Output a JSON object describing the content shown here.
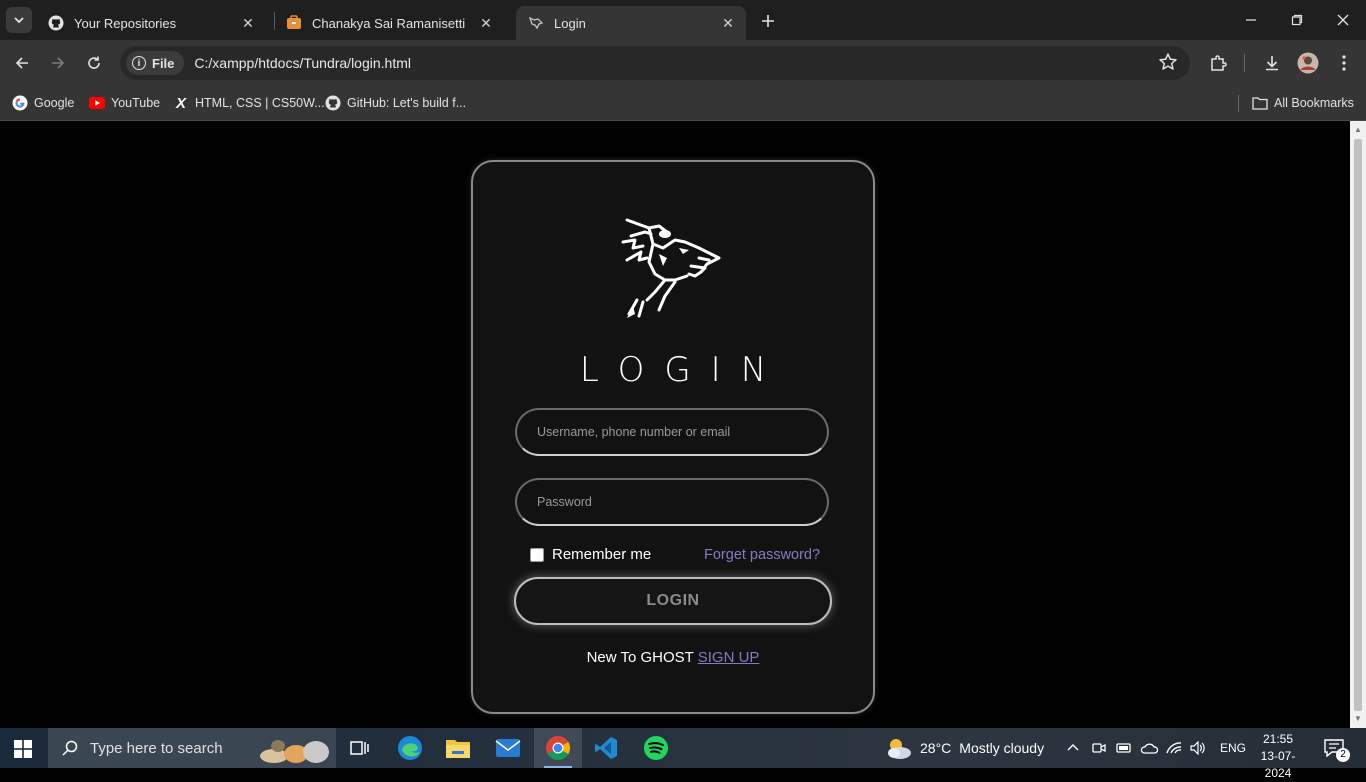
{
  "browser": {
    "tabs": [
      {
        "title": "Your Repositories",
        "favicon": "github-icon",
        "active": false
      },
      {
        "title": "Chanakya Sai Ramanisetti",
        "favicon": "portfolio-icon",
        "active": false
      },
      {
        "title": "Login",
        "favicon": "wolf-icon",
        "active": true
      }
    ],
    "address": {
      "chip": "File",
      "url": "C:/xampp/htdocs/Tundra/login.html"
    },
    "bookmarks": [
      {
        "label": "Google",
        "icon": "google-icon"
      },
      {
        "label": "YouTube",
        "icon": "youtube-icon"
      },
      {
        "label": "HTML, CSS | CS50W...",
        "icon": "x-icon"
      },
      {
        "label": "GitHub: Let's build f...",
        "icon": "github-icon"
      }
    ],
    "all_bookmarks": "All Bookmarks"
  },
  "login": {
    "title": "LOGIN",
    "username_placeholder": "Username, phone number or email",
    "password_placeholder": "Password",
    "remember_label": "Remember me",
    "forget_link": "Forget password?",
    "button_label": "LOGIN",
    "new_text": "New To GHOST",
    "signup_link": "SIGN UP",
    "accent_color": "#8a78c0"
  },
  "taskbar": {
    "search_placeholder": "Type here to search",
    "weather": {
      "temp": "28°C",
      "desc": "Mostly cloudy"
    },
    "language": "ENG",
    "time": "21:55",
    "date": "13-07-2024",
    "notification_count": "2"
  }
}
